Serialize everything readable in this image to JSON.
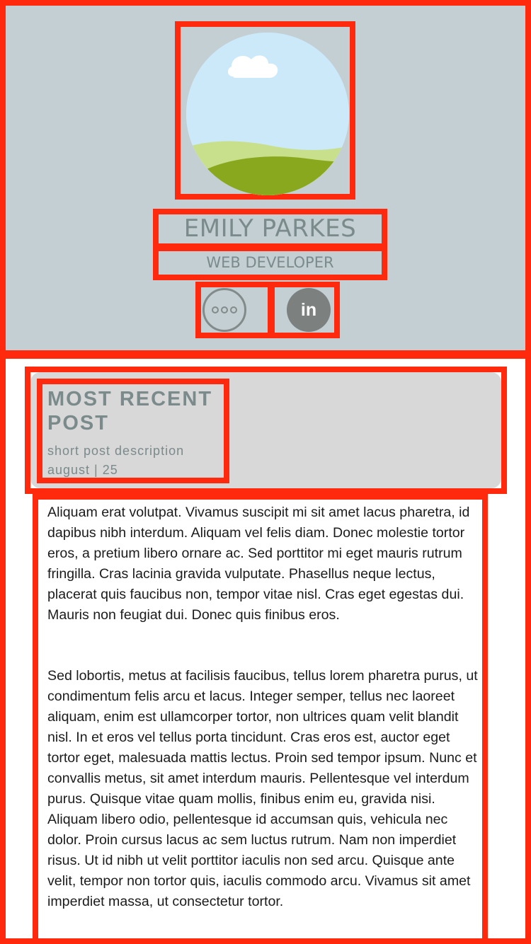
{
  "profile": {
    "name": "EMILY PARKES",
    "role": "WEB DEVELOPER",
    "more_icon": "more-horizontal-icon",
    "linkedin_icon": "linkedin-icon",
    "linkedin_label": "in"
  },
  "post": {
    "heading": "MOST RECENT POST",
    "description": "short post description",
    "date": "august | 25",
    "paragraphs": [
      "Aliquam erat volutpat. Vivamus suscipit mi sit amet lacus pharetra, id dapibus nibh interdum. Aliquam vel felis diam. Donec molestie tortor eros, a pretium libero ornare ac. Sed porttitor mi eget mauris rutrum fringilla. Cras lacinia gravida vulputate. Phasellus neque lectus, placerat quis faucibus non, tempor vitae nisl. Cras eget egestas dui. Mauris non feugiat dui. Donec quis finibus eros.",
      "Sed lobortis, metus at facilisis faucibus, tellus lorem pharetra purus, ut condimentum felis arcu et lacus. Integer semper, tellus nec laoreet aliquam, enim est ullamcorper tortor, non ultrices quam velit blandit nisl. In et eros vel tellus porta tincidunt. Cras eros est, auctor eget tortor eget, malesuada mattis lectus. Proin sed tempor ipsum. Nunc et convallis metus, sit amet interdum mauris. Pellentesque vel interdum purus. Quisque vitae quam mollis, finibus enim eu, gravida nisi. Aliquam libero odio, pellentesque id accumsan quis, vehicula nec dolor. Proin cursus lacus ac sem luctus rutrum. Nam non imperdiet risus. Ut id nibh ut velit porttitor iaculis non sed arcu. Quisque ante velit, tempor non tortor quis, iaculis commodo arcu. Vivamus sit amet imperdiet massa, ut consectetur tortor."
    ]
  },
  "colors": {
    "highlight_border": "#ff2a0e",
    "header_bg": "#c4cfd3",
    "card_bg": "#d8d8d8",
    "muted_text": "#7b8a8b",
    "icon_gray": "#7c8180"
  }
}
